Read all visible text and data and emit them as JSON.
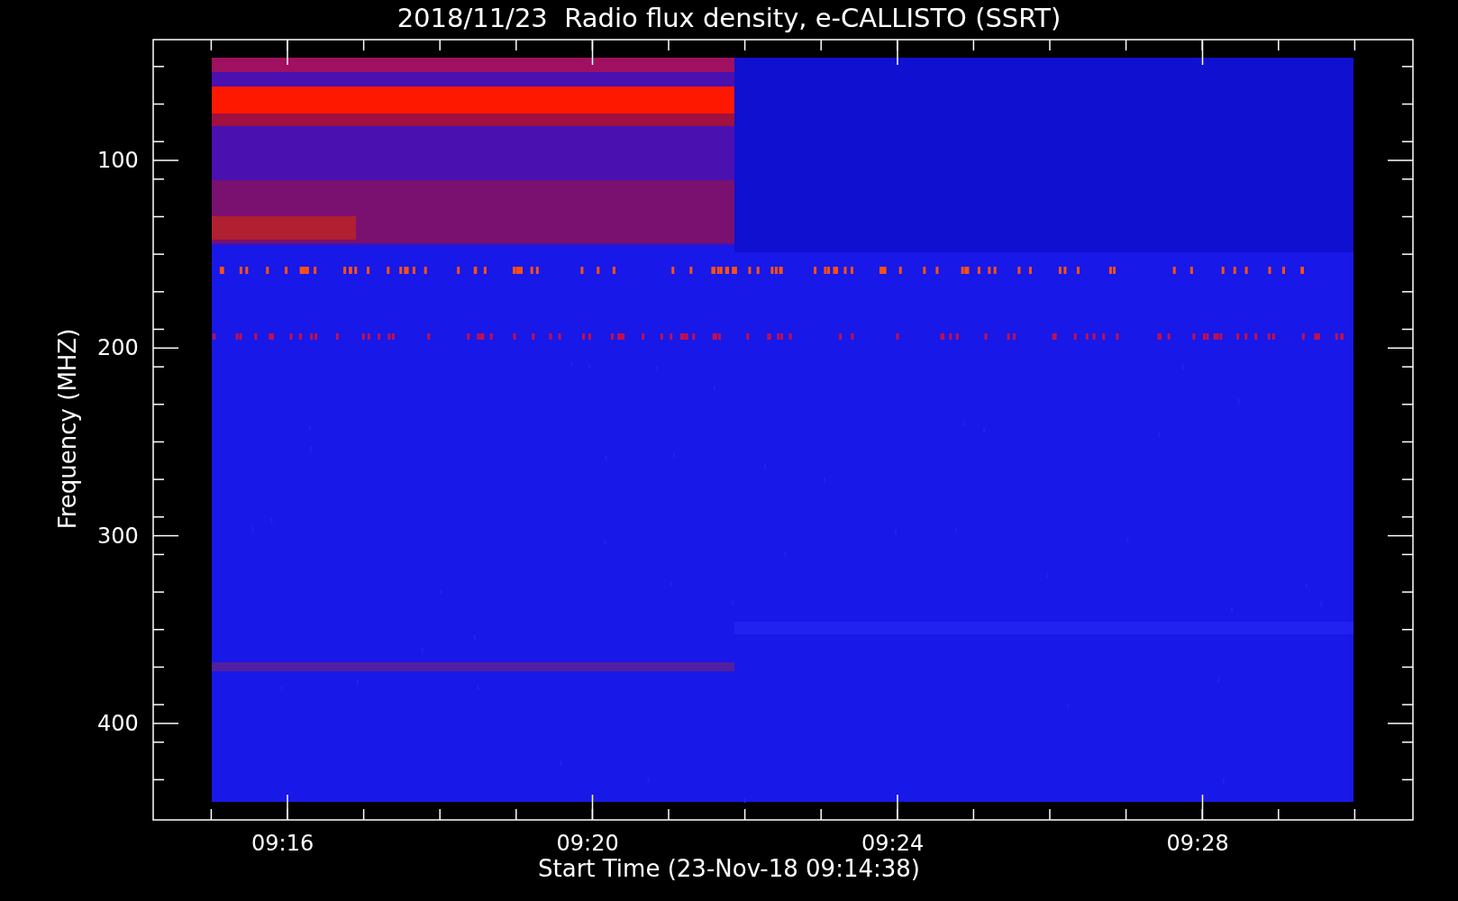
{
  "title": "2018/11/23  Radio flux density, e-CALLISTO (SSRT)",
  "y_axis": {
    "label": "Frequency (MHZ)",
    "ticks": [
      "100",
      "200",
      "300",
      "400"
    ]
  },
  "x_axis": {
    "label": "Start Time (23-Nov-18 09:14:38)",
    "ticks": [
      "09:16",
      "09:20",
      "09:24",
      "09:28"
    ]
  }
}
